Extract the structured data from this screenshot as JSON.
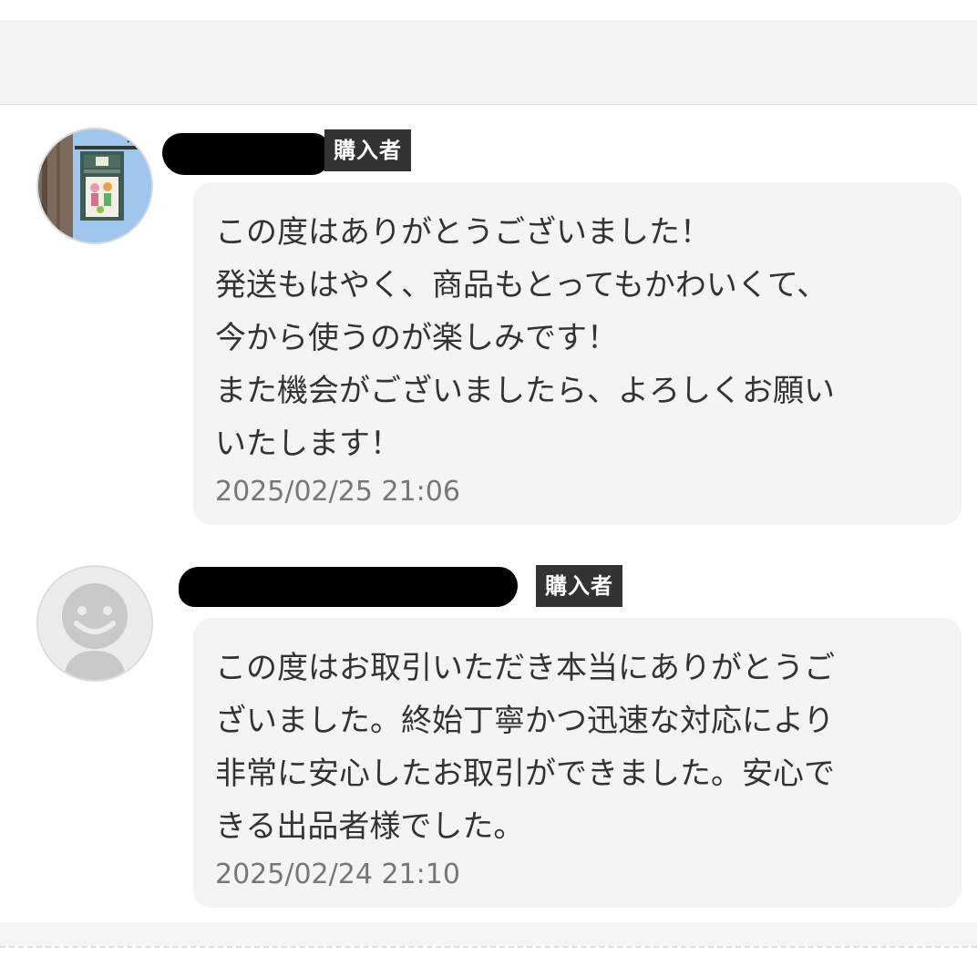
{
  "reviews": [
    {
      "role_badge": "購入者",
      "avatar": "shop-sign-photo",
      "message": "この度はありがとうございました！\n発送もはやく、商品もとってもかわいくて、\n今から使うのが楽しみです！\nまた機会がございましたら、よろしくお願い\nいたします！",
      "timestamp": "2025/02/25 21:06"
    },
    {
      "role_badge": "購入者",
      "avatar": "default-user-icon",
      "message": "この度はお取引いただき本当にありがとうご\nざいました。終始丁寧かつ迅速な対応により\n非常に安心したお取引ができました。安心で\nきる出品者様でした。",
      "timestamp": "2025/02/24 21:10"
    }
  ],
  "colors": {
    "bubble_bg": "#f4f4f4",
    "badge_bg": "#333333",
    "badge_text": "#ffffff",
    "timestamp_text": "#777777",
    "redaction": "#000000"
  }
}
